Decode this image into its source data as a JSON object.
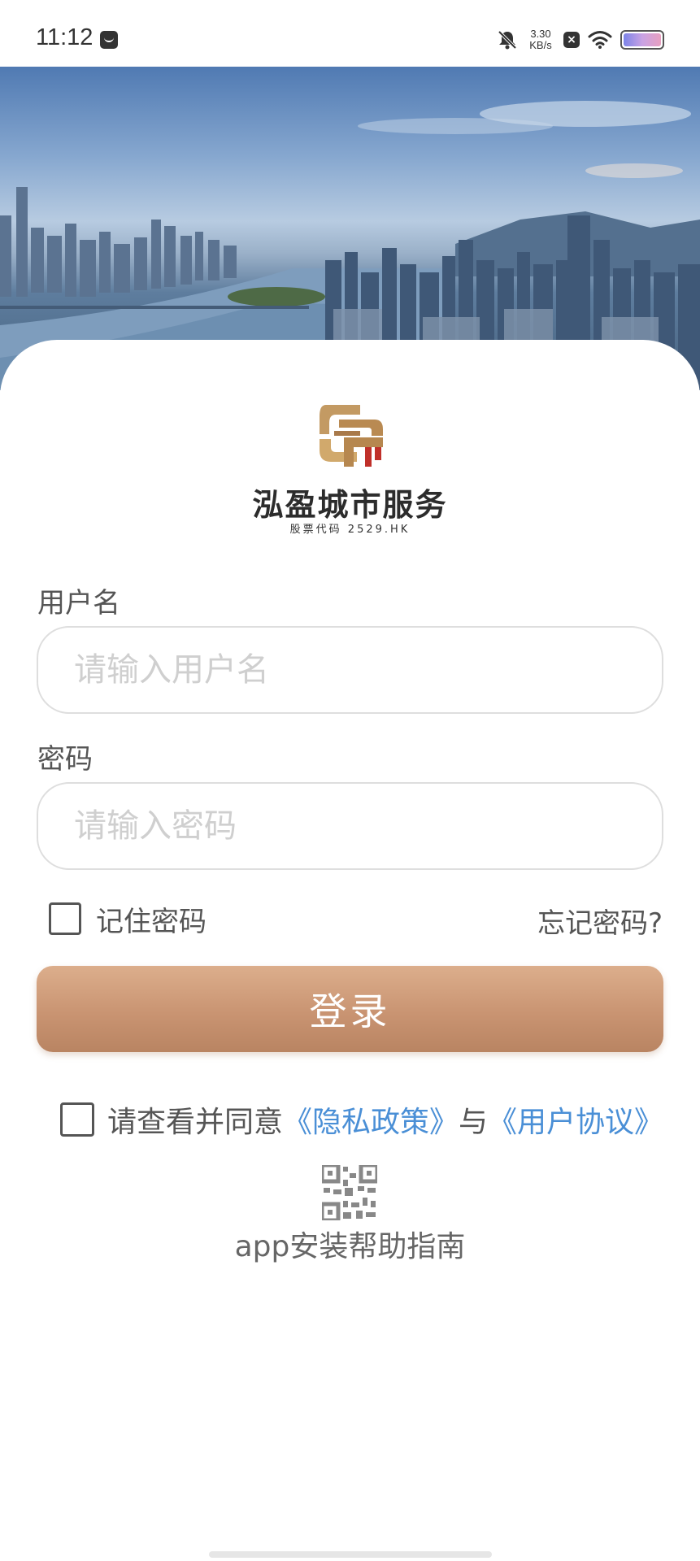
{
  "status_bar": {
    "time": "11:12",
    "net_speed_value": "3.30",
    "net_speed_unit": "KB/s"
  },
  "brand": {
    "company_name": "泓盈城市服务",
    "stock_code": "股票代码 2529.HK"
  },
  "form": {
    "username_label": "用户名",
    "username_placeholder": "请输入用户名",
    "password_label": "密码",
    "password_placeholder": "请输入密码",
    "remember_label": "记住密码",
    "forgot_label": "忘记密码?",
    "login_label": "登录"
  },
  "agreement": {
    "prefix": "请查看并同意",
    "privacy_link": "《隐私政策》",
    "connector": "与",
    "terms_link": "《用户协议》"
  },
  "help": {
    "guide_label": "app安装帮助指南"
  },
  "colors": {
    "accent_button": "#c99472",
    "link": "#4a8fd6"
  },
  "icons": [
    "message-icon",
    "mute-bell-icon",
    "close-box-icon",
    "wifi-icon",
    "battery-icon",
    "qr-code-icon"
  ]
}
